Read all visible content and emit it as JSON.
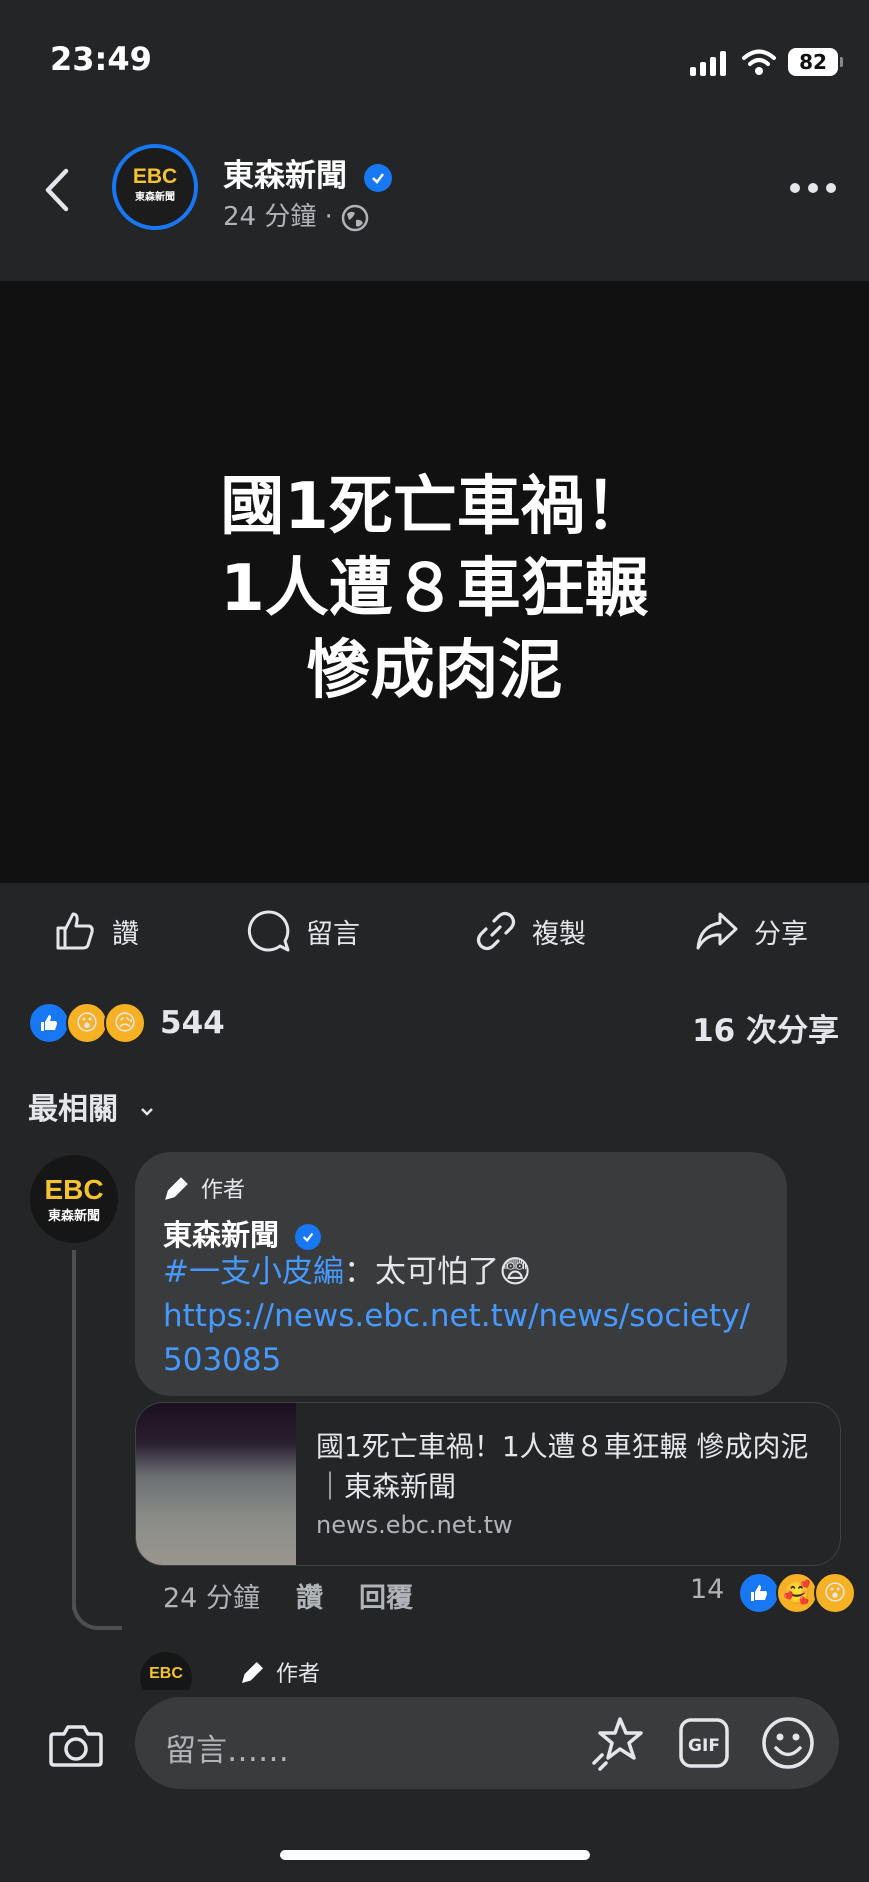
{
  "status_bar": {
    "time": "23:49",
    "battery": "82"
  },
  "header": {
    "page_name": "東森新聞",
    "post_time": "24 分鐘 · ",
    "logo_main": "EBC",
    "logo_sub": "東森新聞"
  },
  "post": {
    "headline_lines": [
      "國1死亡車禍！",
      "1人遭８車狂輾",
      "慘成肉泥"
    ]
  },
  "actions": {
    "like": "讚",
    "comment": "留言",
    "copy": "複製",
    "share": "分享"
  },
  "stats": {
    "reaction_count": "544",
    "share_count": "16 次分享"
  },
  "sort": {
    "label": "最相關"
  },
  "comment": {
    "author_badge": "作者",
    "author": "東森新聞",
    "hashtag": "#一支小皮編",
    "text": "：太可怕了😨",
    "link": "https://news.ebc.net.tw/news/society/503085",
    "preview_title": "國1死亡車禍！1人遭８車狂輾 慘成肉泥｜東森新聞",
    "preview_domain": "news.ebc.net.tw",
    "time": "24 分鐘",
    "like": "讚",
    "reply": "回覆",
    "reaction_count": "14"
  },
  "reply_preview": {
    "author_badge": "作者"
  },
  "composer": {
    "placeholder": "留言……"
  },
  "colors": {
    "accent": "#1877f2",
    "link": "#4599ff",
    "bg": "#242526",
    "bubble": "#3a3b3c"
  },
  "icons": [
    "back-arrow-icon",
    "verified-icon",
    "globe-icon",
    "more-icon",
    "like-icon",
    "comment-icon",
    "link-icon",
    "share-icon",
    "pen-icon",
    "camera-icon",
    "avatar-sticker-icon",
    "gif-icon",
    "emoji-icon"
  ]
}
